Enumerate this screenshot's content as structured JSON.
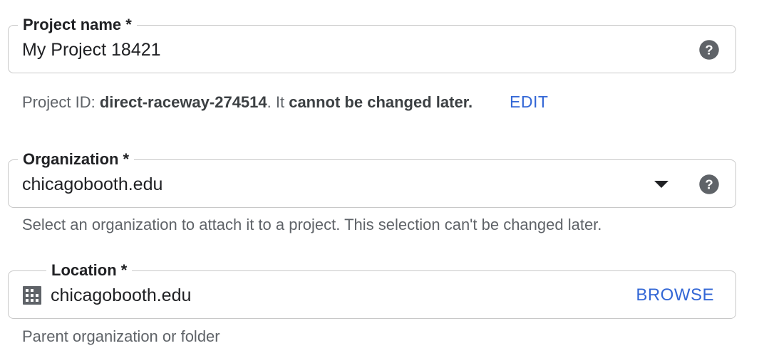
{
  "project_name": {
    "label": "Project name *",
    "value": "My Project 18421",
    "help_icon": "help-circle-icon"
  },
  "project_id": {
    "prefix": "Project ID: ",
    "id": "direct-raceway-274514",
    "middle": ". It ",
    "emphasis": "cannot be changed later.",
    "edit_label": "EDIT"
  },
  "organization": {
    "label": "Organization *",
    "value": "chicagobooth.edu",
    "dropdown_icon": "arrow-drop-down-icon",
    "help_icon": "help-circle-icon",
    "helper": "Select an organization to attach it to a project. This selection can't be changed later."
  },
  "location": {
    "label": "Location *",
    "value": "chicagobooth.edu",
    "icon": "building-icon",
    "browse_label": "BROWSE",
    "helper": "Parent organization or folder"
  },
  "colors": {
    "accent": "#3367d6",
    "border": "#c8c8c8",
    "helper_text": "#5f6368",
    "icon": "#5f6368"
  }
}
